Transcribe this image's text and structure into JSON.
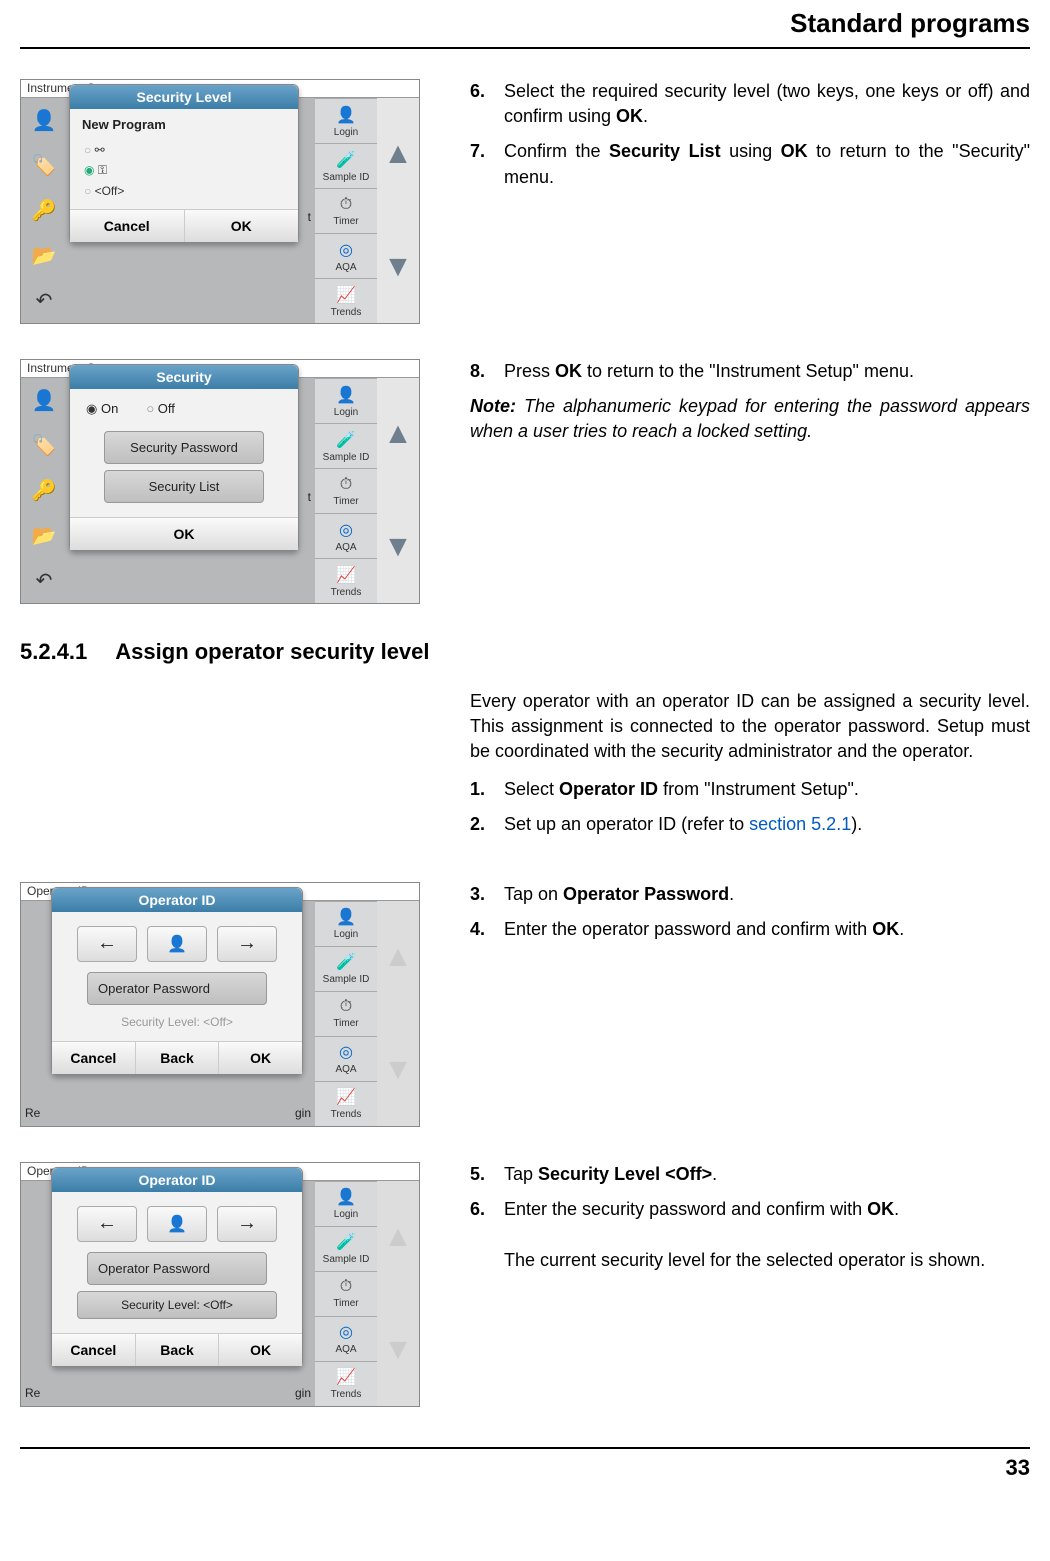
{
  "header": {
    "title": "Standard programs"
  },
  "footer": {
    "page": "33"
  },
  "side_labels": {
    "login": "Login",
    "sample": "Sample ID",
    "timer": "Timer",
    "aqa": "AQA",
    "trends": "Trends"
  },
  "heading": {
    "number": "5.2.4.1",
    "text": "Assign operator security level"
  },
  "shot1": {
    "bg_header": "Instrument Setup",
    "leak_right": "t",
    "dialog_title": "Security Level",
    "body_title": "New Program",
    "opt_two": "⚯",
    "opt_one": "⚿",
    "opt_off": "<Off>",
    "btn_cancel": "Cancel",
    "btn_ok": "OK"
  },
  "shot2": {
    "bg_header": "Instrument Setup",
    "leak_right": "t",
    "dialog_title": "Security",
    "radio_on": "On",
    "radio_off": "Off",
    "btn_sec_pw": "Security Password",
    "btn_sec_list": "Security List",
    "btn_ok": "OK"
  },
  "shot3": {
    "bg_header": "Operator ID",
    "leak_left": "Re",
    "leak_right": "gin",
    "dialog_title": "Operator ID",
    "btn_op_pw": "Operator Password",
    "sec_level": "Security Level:   <Off>",
    "btn_cancel": "Cancel",
    "btn_back": "Back",
    "btn_ok": "OK"
  },
  "shot4": {
    "bg_header": "Operator ID",
    "leak_left": "Re",
    "leak_right": "gin",
    "dialog_title": "Operator ID",
    "btn_op_pw": "Operator Password",
    "sec_level": "Security Level:   <Off>",
    "btn_cancel": "Cancel",
    "btn_back": "Back",
    "btn_ok": "OK"
  },
  "text": {
    "s6": "Select the required security level (two keys, one keys or off) and confirm using ",
    "s6b": ".",
    "s7a": "Confirm the ",
    "s7b": " using ",
    "s7c": " to return to the \"Security\" menu.",
    "s8a": "Press ",
    "s8b": " to return to the \"Instrument Setup\" menu.",
    "note_label": "Note:",
    "note_body": " The alphanumeric keypad for entering the password appears when a user tries to reach a locked setting.",
    "intro": "Every operator with an operator ID can be assigned a security level. This assignment is connected to the operator password. Setup must be coordinated with the security administrator and the operator.",
    "s1a": "Select ",
    "s1b": " from \"Instrument Setup\".",
    "s2a": "Set up an operator ID (refer to ",
    "s2link": "section 5.2.1",
    "s2b": ").",
    "s3a": "Tap on ",
    "s3b": ".",
    "s4a": "Enter the operator password and confirm with ",
    "s4b": ".",
    "s5a": "Tap ",
    "s5b": ".",
    "s6ea": "Enter the security password and confirm with ",
    "s6eb": ".",
    "s6f": "The current security level for the selected operator is shown.",
    "bold": {
      "ok": "OK",
      "security_list": "Security List",
      "operator_id": "Operator ID",
      "operator_pw": "Operator Password",
      "sec_off": "Security Level <Off>"
    }
  }
}
